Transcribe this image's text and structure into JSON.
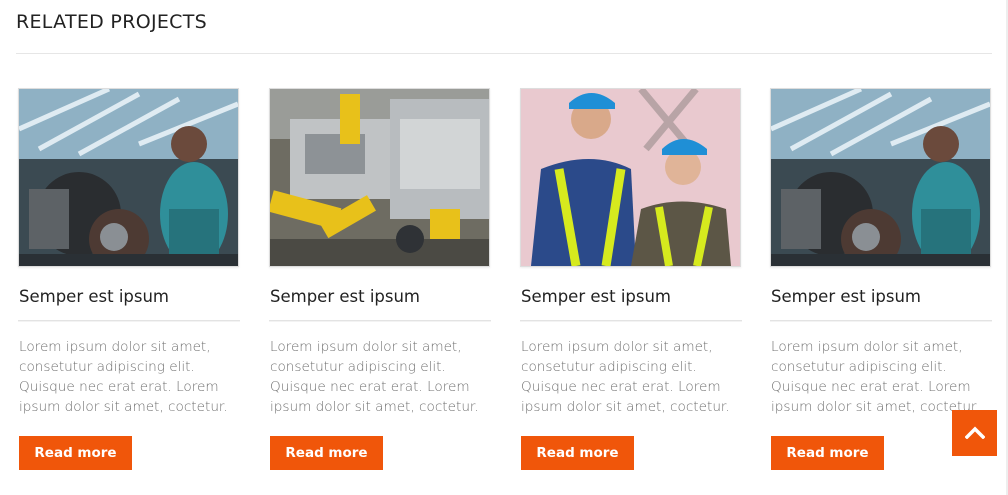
{
  "section": {
    "title": "RELATED PROJECTS"
  },
  "projects": [
    {
      "title": "Semper est ipsum",
      "description": "Lorem ipsum dolor sit amet, consetutur adipiscing elit. Quisque nec erat erat. Lorem ipsum dolor sit amet, coctetur.",
      "button": "Read more",
      "image": "factory-worker-engine-photo"
    },
    {
      "title": "Semper est ipsum",
      "description": "Lorem ipsum dolor sit amet, consetutur adipiscing elit. Quisque nec erat erat. Lorem ipsum dolor sit amet, coctetur.",
      "button": "Read more",
      "image": "robotic-car-assembly-photo"
    },
    {
      "title": "Semper est ipsum",
      "description": "Lorem ipsum dolor sit amet, consetutur adipiscing elit. Quisque nec erat erat. Lorem ipsum dolor sit amet, coctetur.",
      "button": "Read more",
      "image": "workers-hard-hats-photo"
    },
    {
      "title": "Semper est ipsum",
      "description": "Lorem ipsum dolor sit amet, consetutur adipiscing elit. Quisque nec erat erat. Lorem ipsum dolor sit amet, coctetur.",
      "button": "Read more",
      "image": "factory-worker-engine-photo"
    }
  ],
  "scroll_top": {
    "icon": "chevron-up-icon"
  },
  "colors": {
    "accent": "#f0560a",
    "text": "#222222",
    "muted": "#6f6f6f",
    "rule": "#e6e6e6"
  }
}
